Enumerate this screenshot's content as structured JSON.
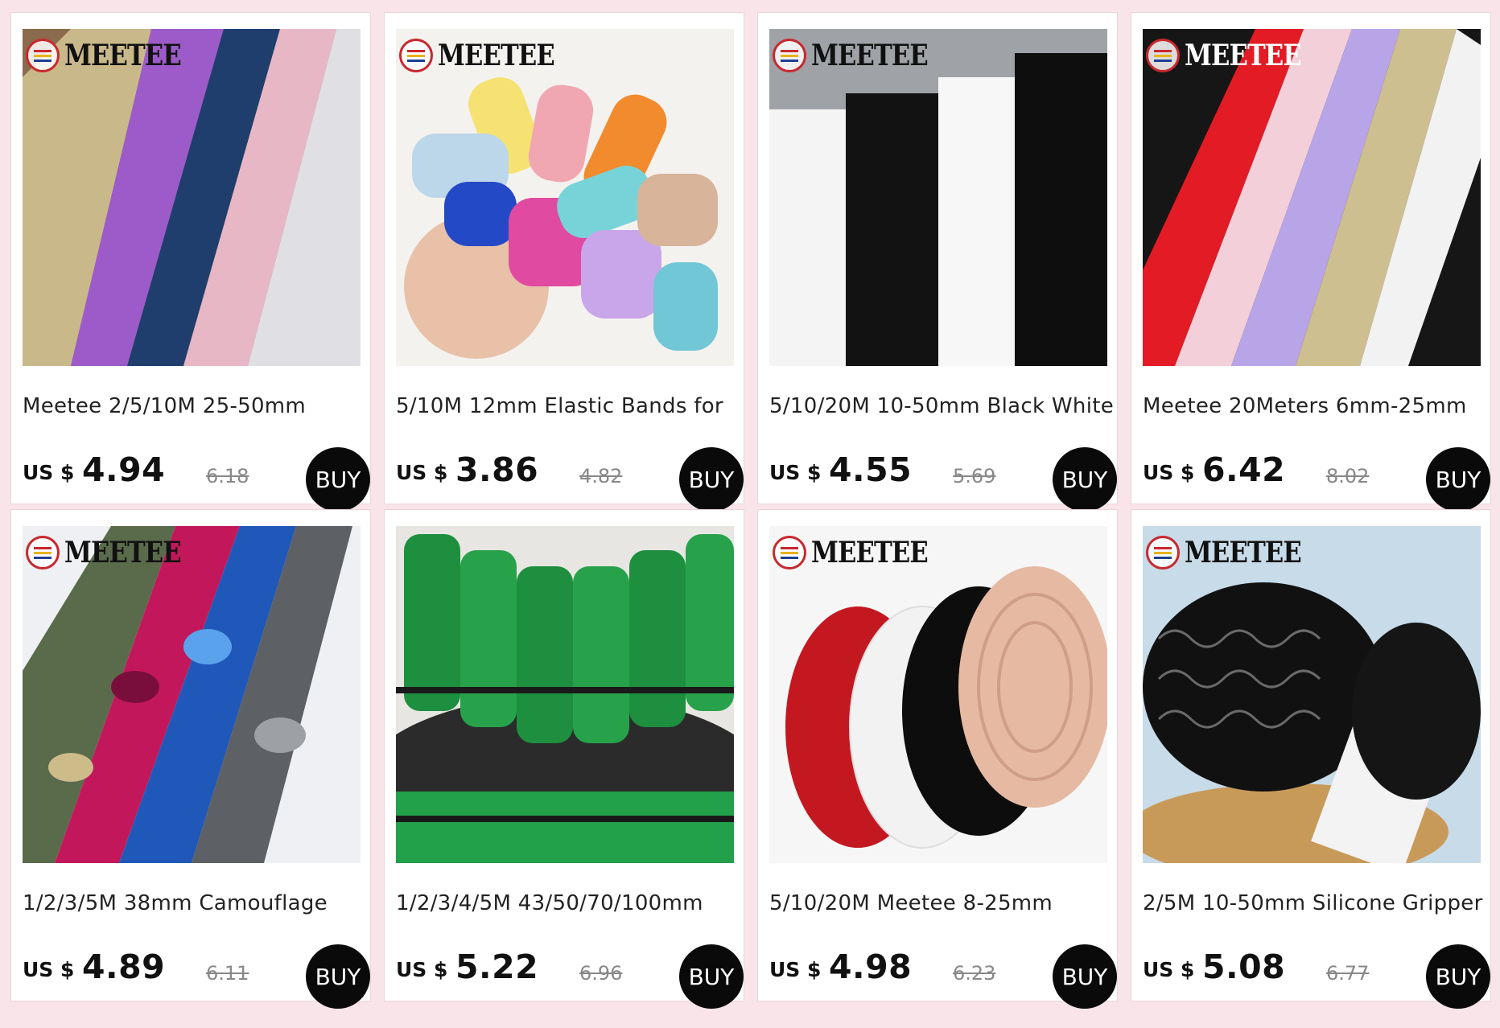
{
  "currency": "US $",
  "buy_label": "BUY",
  "logo_text": "MEETEE",
  "products": [
    {
      "title": "Meetee 2/5/10M 25-50mm",
      "price": "4.94",
      "old_price": "6.18",
      "logo": true
    },
    {
      "title": "5/10M 12mm Elastic Bands for",
      "price": "3.86",
      "old_price": "4.82",
      "logo": true
    },
    {
      "title": "5/10/20M 10-50mm Black White",
      "price": "4.55",
      "old_price": "5.69",
      "logo": true
    },
    {
      "title": "Meetee 20Meters 6mm-25mm",
      "price": "6.42",
      "old_price": "8.02",
      "logo": true
    },
    {
      "title": "1/2/3/5M 38mm Camouflage",
      "price": "4.89",
      "old_price": "6.11",
      "logo": true
    },
    {
      "title": "1/2/3/4/5M 43/50/70/100mm",
      "price": "5.22",
      "old_price": "6.96",
      "logo": false
    },
    {
      "title": "5/10/20M Meetee 8-25mm",
      "price": "4.98",
      "old_price": "6.23",
      "logo": true
    },
    {
      "title": "2/5M 10-50mm Silicone Gripper",
      "price": "5.08",
      "old_price": "6.77",
      "logo": true
    }
  ]
}
